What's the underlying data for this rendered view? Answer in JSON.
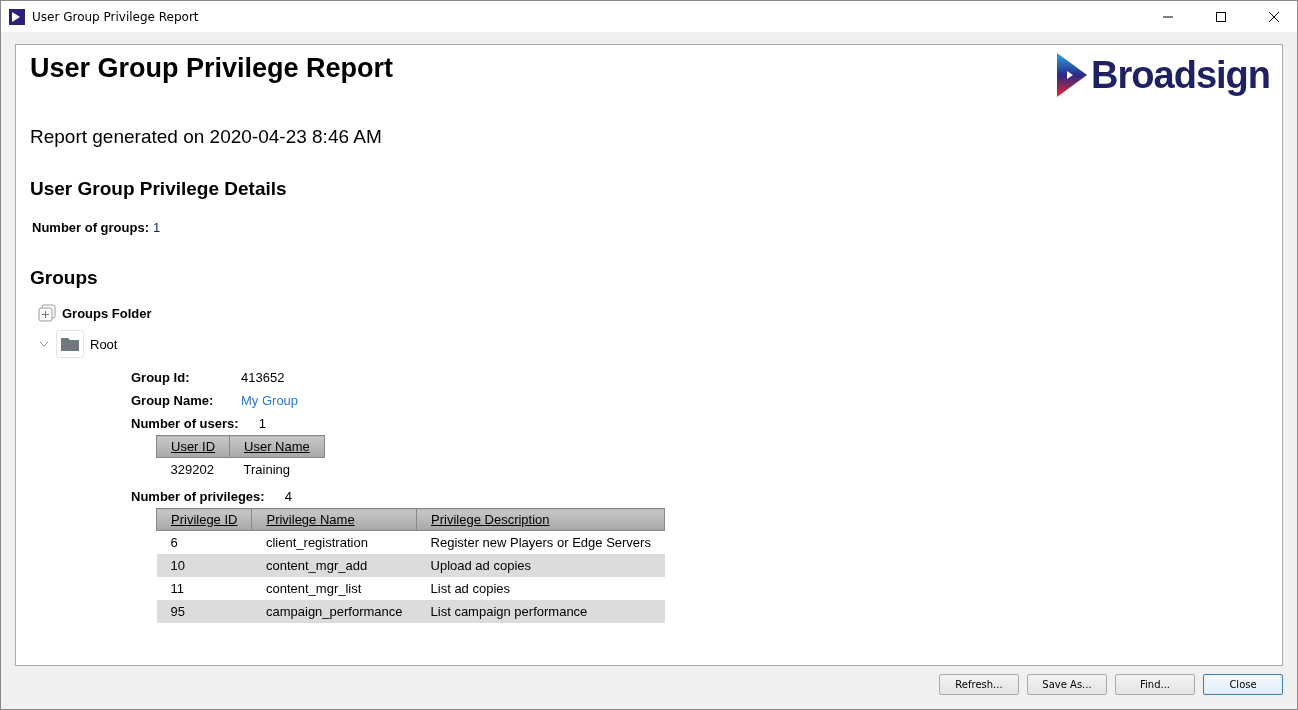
{
  "window": {
    "title": "User Group Privilege Report"
  },
  "report": {
    "title": "User Group Privilege Report",
    "logo_text": "Broadsign",
    "generated": "Report generated on 2020-04-23 8:46 AM",
    "details_heading": "User Group Privilege Details",
    "groups_count_label": "Number of groups:",
    "groups_count": "1",
    "groups_heading": "Groups",
    "tree": [
      {
        "label": "Groups Folder",
        "kind": "folder-group",
        "expanded": false
      },
      {
        "label": "Root",
        "kind": "folder",
        "expanded": true,
        "fields": [
          {
            "label": "Group Id:",
            "value": "413652",
            "kind": "text"
          },
          {
            "label": "Group Name:",
            "value": "My Group",
            "kind": "link"
          }
        ],
        "users_label": "Number of users:",
        "users_count": "1",
        "users_table": {
          "columns": [
            "User ID",
            "User Name"
          ],
          "rows": [
            [
              "329202",
              "Training"
            ]
          ]
        },
        "privileges_label": "Number of privileges:",
        "privileges_count": "4",
        "privileges_table": {
          "columns": [
            "Privilege ID",
            "Privilege Name",
            "Privilege Description"
          ],
          "rows": [
            [
              "6",
              "client_registration",
              "Register new Players or Edge Servers"
            ],
            [
              "10",
              "content_mgr_add",
              "Upload ad copies"
            ],
            [
              "11",
              "content_mgr_list",
              "List ad copies"
            ],
            [
              "95",
              "campaign_performance",
              "List campaign performance"
            ]
          ]
        }
      }
    ]
  },
  "buttons": [
    {
      "label": "Refresh...",
      "default": false
    },
    {
      "label": "Save As...",
      "default": false
    },
    {
      "label": "Find...",
      "default": false
    },
    {
      "label": "Close",
      "default": true
    }
  ]
}
